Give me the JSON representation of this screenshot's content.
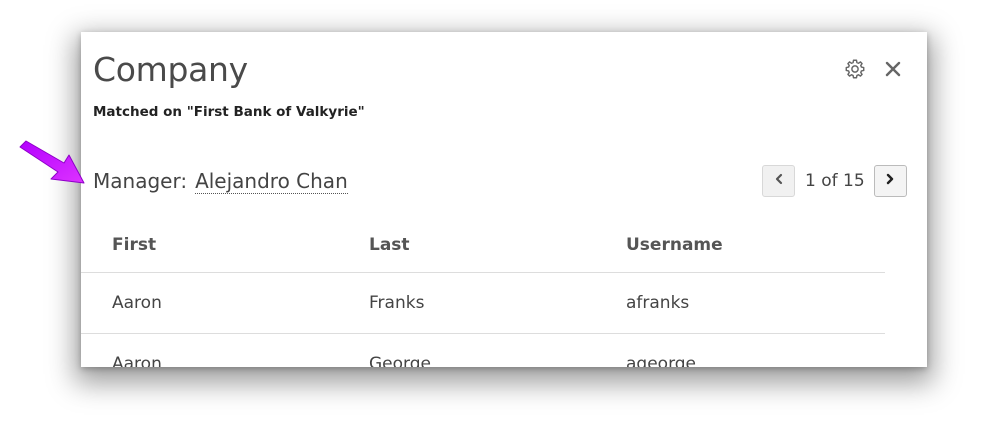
{
  "dialog": {
    "title": "Company",
    "subtitle": "Matched on \"First Bank of Valkyrie\"",
    "settings_icon": "gear-icon",
    "close_icon": "close-icon"
  },
  "manager": {
    "label": "Manager:",
    "name": "Alejandro Chan"
  },
  "pager": {
    "text": "1 of 15",
    "current": 1,
    "total": 15,
    "prev_icon": "chevron-left-icon",
    "next_icon": "chevron-right-icon"
  },
  "table": {
    "headers": [
      "First",
      "Last",
      "Username"
    ],
    "rows": [
      [
        "Aaron",
        "Franks",
        "afranks"
      ],
      [
        "Aaron",
        "George",
        "ageorge"
      ]
    ]
  },
  "annotation": {
    "arrow_color": "#cc00ff"
  }
}
